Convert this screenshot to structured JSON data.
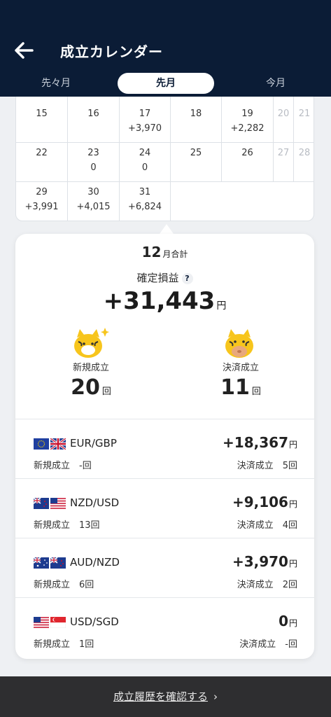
{
  "header": {
    "title": "成立カレンダー"
  },
  "tabs": [
    {
      "label": "先々月"
    },
    {
      "label": "先月"
    },
    {
      "label": "今月"
    }
  ],
  "calendar": {
    "rows": [
      [
        {
          "day": "15",
          "value": ""
        },
        {
          "day": "16",
          "value": ""
        },
        {
          "day": "17",
          "value": "+3,970"
        },
        {
          "day": "18",
          "value": ""
        },
        {
          "day": "19",
          "value": "+2,282"
        },
        {
          "day": "20",
          "value": ""
        },
        {
          "day": "21",
          "value": ""
        }
      ],
      [
        {
          "day": "22",
          "value": ""
        },
        {
          "day": "23",
          "value": "0"
        },
        {
          "day": "24",
          "value": "0"
        },
        {
          "day": "25",
          "value": ""
        },
        {
          "day": "26",
          "value": ""
        },
        {
          "day": "27",
          "value": ""
        },
        {
          "day": "28",
          "value": ""
        }
      ],
      [
        {
          "day": "29",
          "value": "+3,991"
        },
        {
          "day": "30",
          "value": "+4,015"
        },
        {
          "day": "31",
          "value": "+6,824"
        }
      ]
    ]
  },
  "summary": {
    "month_num": "12",
    "month_suffix": "月合計",
    "pl_label": "確定損益",
    "help": "?",
    "total": "+31,443",
    "yen": "円",
    "new_label": "新規成立",
    "new_count": "20",
    "close_label": "決済成立",
    "close_count": "11",
    "unit": "回"
  },
  "pairs": [
    {
      "symbol": "EUR/GBP",
      "pl": "+18,367",
      "yen": "円",
      "new": "新規成立　-回",
      "close": "決済成立　5回"
    },
    {
      "symbol": "NZD/USD",
      "pl": "+9,106",
      "yen": "円",
      "new": "新規成立　13回",
      "close": "決済成立　4回"
    },
    {
      "symbol": "AUD/NZD",
      "pl": "+3,970",
      "yen": "円",
      "new": "新規成立　6回",
      "close": "決済成立　2回"
    },
    {
      "symbol": "USD/SGD",
      "pl": "0",
      "yen": "円",
      "new": "新規成立　1回",
      "close": "決済成立　-回"
    }
  ],
  "footer": {
    "link": "成立履歴を確認する",
    "chevron": "›"
  },
  "icons": [
    "back-arrow-icon",
    "help-icon",
    "tiger-mascot-icon",
    "eu-flag-icon",
    "uk-flag-icon",
    "nz-flag-icon",
    "us-flag-icon",
    "au-flag-icon",
    "sg-flag-icon",
    "chevron-right-icon"
  ],
  "colors": {
    "header": "#0b1c36",
    "footer": "#2e2e30",
    "background": "#eef0f3"
  }
}
